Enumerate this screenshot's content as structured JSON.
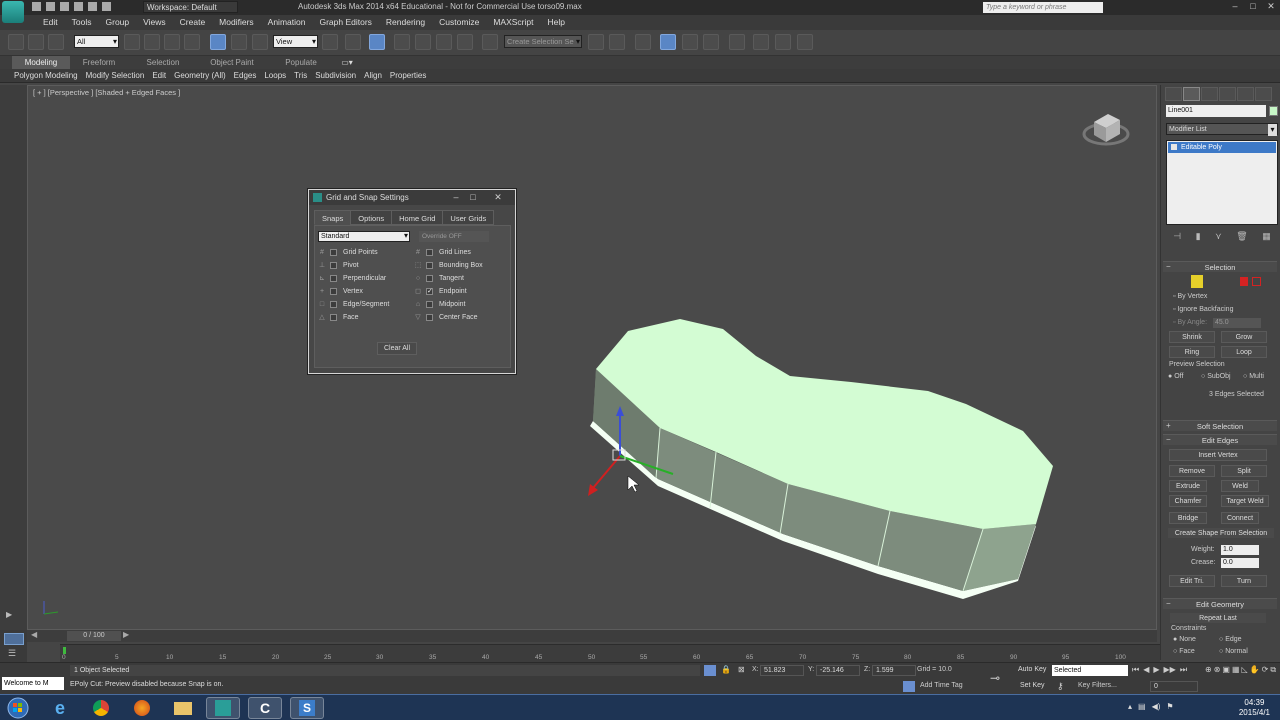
{
  "titlebar": {
    "workspace": "Workspace: Default",
    "title": "Autodesk 3ds Max  2014 x64   Educational - Not for Commercial Use    torso09.max",
    "search_placeholder": "Type a keyword or phrase"
  },
  "menu": [
    "Edit",
    "Tools",
    "Group",
    "Views",
    "Create",
    "Modifiers",
    "Animation",
    "Graph Editors",
    "Rendering",
    "Customize",
    "MAXScript",
    "Help"
  ],
  "toolbar": {
    "filter": "All",
    "view": "View",
    "selection_set": "Create Selection Se"
  },
  "ribbon": {
    "tabs": [
      "Modeling",
      "Freeform",
      "Selection",
      "Object Paint",
      "Populate"
    ],
    "sub": [
      "Polygon Modeling",
      "Modify Selection",
      "Edit",
      "Geometry (All)",
      "Edges",
      "Loops",
      "Tris",
      "Subdivision",
      "Align",
      "Properties"
    ]
  },
  "viewport": {
    "label": "[ + ] [Perspective ] [Shaded + Edged Faces ]"
  },
  "dialog": {
    "title": "Grid and Snap Settings",
    "tabs": [
      "Snaps",
      "Options",
      "Home Grid",
      "User Grids"
    ],
    "standard": "Standard",
    "override": "Override OFF",
    "left_items": [
      {
        "label": "Grid Points",
        "glyph": "#",
        "checked": false
      },
      {
        "label": "Pivot",
        "glyph": "⊥",
        "checked": false
      },
      {
        "label": "Perpendicular",
        "glyph": "⊾",
        "checked": false
      },
      {
        "label": "Vertex",
        "glyph": "+",
        "checked": false
      },
      {
        "label": "Edge/Segment",
        "glyph": "□",
        "checked": false
      },
      {
        "label": "Face",
        "glyph": "△",
        "checked": false
      }
    ],
    "right_items": [
      {
        "label": "Grid Lines",
        "glyph": "#",
        "checked": false
      },
      {
        "label": "Bounding Box",
        "glyph": "⬚",
        "checked": false
      },
      {
        "label": "Tangent",
        "glyph": "○",
        "checked": false
      },
      {
        "label": "Endpoint",
        "glyph": "◻",
        "checked": true
      },
      {
        "label": "Midpoint",
        "glyph": "⌂",
        "checked": false
      },
      {
        "label": "Center Face",
        "glyph": "▽",
        "checked": false
      }
    ],
    "clear_all": "Clear All"
  },
  "cmdpanel": {
    "object_name": "Line001",
    "modifier_list": "Modifier List",
    "stack_item": "Editable Poly",
    "selection": {
      "header": "Selection",
      "by_vertex": "By Vertex",
      "ignore_backfacing": "Ignore Backfacing",
      "by_angle": "By Angle:",
      "angle": "45.0",
      "shrink": "Shrink",
      "grow": "Grow",
      "ring": "Ring",
      "loop": "Loop",
      "preview": "Preview Selection",
      "off": "Off",
      "subobj": "SubObj",
      "multi": "Multi",
      "info": "3 Edges Selected"
    },
    "soft_selection": "Soft Selection",
    "edit_edges": {
      "header": "Edit Edges",
      "insert_vertex": "Insert Vertex",
      "remove": "Remove",
      "split": "Split",
      "extrude": "Extrude",
      "weld": "Weld",
      "chamfer": "Chamfer",
      "target_weld": "Target Weld",
      "bridge": "Bridge",
      "connect": "Connect",
      "create_shape": "Create Shape From Selection",
      "weight_lbl": "Weight:",
      "weight": "1.0",
      "crease_lbl": "Crease:",
      "crease": "0.0",
      "edit_tri": "Edit Tri.",
      "turn": "Turn"
    },
    "edit_geometry": {
      "header": "Edit Geometry",
      "repeat_last": "Repeat Last",
      "constraints": "Constraints",
      "none": "None",
      "edge": "Edge",
      "face": "Face",
      "normal": "Normal"
    }
  },
  "timeline": {
    "slider": "0 / 100",
    "ticks": [
      "0",
      "5",
      "10",
      "15",
      "20",
      "25",
      "30",
      "35",
      "40",
      "45",
      "50",
      "55",
      "60",
      "65",
      "70",
      "75",
      "80",
      "85",
      "90",
      "95",
      "100"
    ]
  },
  "status": {
    "maxscript": "Welcome to M",
    "selected": "1 Object Selected",
    "prompt": "EPoly Cut: Preview disabled because Snap is on.",
    "x_lbl": "X:",
    "x": "51.823",
    "y_lbl": "Y:",
    "y": "-25.146",
    "z_lbl": "Z:",
    "z": "1.599",
    "grid": "Grid = 10.0",
    "add_time_tag": "Add Time Tag",
    "auto_key": "Auto Key",
    "set_key": "Set Key",
    "selected_drop": "Selected",
    "key_filters": "Key Filters...",
    "frame": "0"
  },
  "taskbar": {
    "time": "04:39",
    "date": "2015/4/1"
  }
}
